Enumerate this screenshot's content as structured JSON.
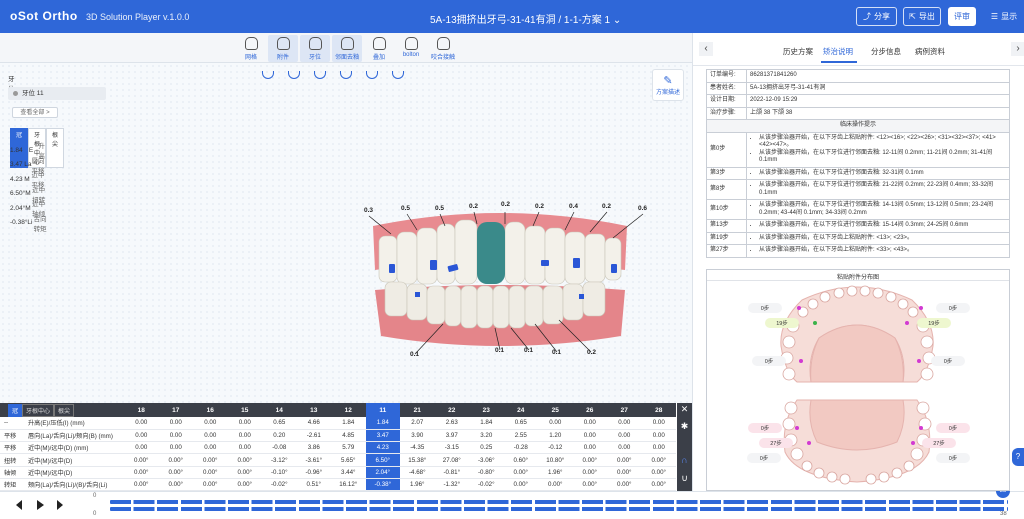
{
  "header": {
    "logo": "oSot Ortho",
    "app_name": "3D Solution Player v.1.0.0",
    "doc_title": "5A-13拥挤出牙弓-31-41有洞 / 1-1-方案 1",
    "share": "分享",
    "export": "导出",
    "review": "评审",
    "show": "显示"
  },
  "toolbar": [
    "网格",
    "附件",
    "牙位",
    "邻面去釉",
    "叠加",
    "bolton",
    "咬合接触"
  ],
  "plan_button": "方案描述",
  "left_panel": {
    "title": "牙位",
    "tooth": "牙位 11",
    "view_all": "查看全部 >",
    "tabs": [
      "冠",
      "牙根中心",
      "根尖"
    ],
    "rows": [
      {
        "v": "1.84",
        "c": "E",
        "d": "升高"
      },
      {
        "v": "3.47",
        "c": "La",
        "d": "唇向 平移"
      },
      {
        "v": "4.23",
        "c": "M",
        "d": "近中 平移"
      },
      {
        "v": "6.50°",
        "c": "M",
        "d": "近中 扭转"
      },
      {
        "v": "2.04°",
        "c": "M",
        "d": "近中 轴倾"
      },
      {
        "v": "-0.38°",
        "c": "Li",
        "d": "舌向 转矩"
      }
    ]
  },
  "tooth_tags_top": [
    "0.3",
    "0.5",
    "0.5",
    "0.2",
    "0.2",
    "0.2",
    "0.4",
    "0.2",
    "0.6"
  ],
  "tooth_tags_bottom": [
    "0.1",
    "0.1",
    "0.1",
    "0.1",
    "0.2"
  ],
  "bottom_table": {
    "tabs": [
      "冠",
      "牙根中心",
      "根尖"
    ],
    "teeth": [
      "18",
      "17",
      "16",
      "15",
      "14",
      "13",
      "12",
      "11",
      "21",
      "22",
      "23",
      "24",
      "25",
      "26",
      "27",
      "28"
    ],
    "rows": [
      {
        "c0": "--",
        "label": "升高(E)/压低(I) (mm)",
        "vals": [
          "0.00",
          "0.00",
          "0.00",
          "0.00",
          "0.65",
          "4.66",
          "1.84",
          "1.84",
          "2.07",
          "2.63",
          "1.84",
          "0.65",
          "0.00",
          "0.00",
          "0.00",
          "0.00"
        ]
      },
      {
        "c0": "平移",
        "label": "唇向(La)/舌向(Li)/颊向(B) (mm)",
        "vals": [
          "0.00",
          "0.00",
          "0.00",
          "0.00",
          "0.20",
          "-2.61",
          "4.85",
          "3.47",
          "3.90",
          "3.97",
          "3.20",
          "2.55",
          "1.20",
          "0.00",
          "0.00",
          "0.00"
        ]
      },
      {
        "c0": "平移",
        "label": "近中(M)/远中(D) (mm)",
        "vals": [
          "0.00",
          "0.00",
          "0.00",
          "0.00",
          "-0.08",
          "3.86",
          "5.79",
          "4.23",
          "-4.35",
          "-3.15",
          "0.25",
          "-0.28",
          "-0.12",
          "0.00",
          "0.00",
          "0.00"
        ]
      },
      {
        "c0": "扭转",
        "label": "近中(M)/远中(D)",
        "vals": [
          "0.00°",
          "0.00°",
          "0.00°",
          "0.00°",
          "-3.12°",
          "-3.61°",
          "5.65°",
          "6.50°",
          "15.38°",
          "27.08°",
          "-3.06°",
          "0.60°",
          "10.80°",
          "0.00°",
          "0.00°",
          "0.00°"
        ]
      },
      {
        "c0": "轴倾",
        "label": "近中(M)/远中(D)",
        "vals": [
          "0.00°",
          "0.00°",
          "0.00°",
          "0.00°",
          "-0.10°",
          "-0.96°",
          "3.44°",
          "2.04°",
          "-4.68°",
          "-0.81°",
          "-0.80°",
          "0.00°",
          "1.96°",
          "0.00°",
          "0.00°",
          "0.00°"
        ]
      },
      {
        "c0": "转矩",
        "label": "颊向(La)/舌向(Li)/(B)/舌向(Li)",
        "vals": [
          "0.00°",
          "0.00°",
          "0.00°",
          "0.00°",
          "-0.02°",
          "0.51°",
          "16.12°",
          "-0.38°",
          "1.96°",
          "-1.32°",
          "-0.02°",
          "0.00°",
          "0.00°",
          "0.00°",
          "0.00°",
          "0.00°"
        ]
      }
    ]
  },
  "timeline": {
    "start_top": "0",
    "start_bottom": "0",
    "end": "38",
    "current": "38"
  },
  "right_panel": {
    "tabs": [
      "历史方案",
      "矫治说明",
      "分步信息",
      "病例资料"
    ],
    "info": [
      {
        "k": "订单编号:",
        "v": "86281371841260"
      },
      {
        "k": "患者姓名:",
        "v": "5A-13拥挤出牙弓-31-41有洞"
      },
      {
        "k": "设计日期:",
        "v": "2022-12-09 15:29"
      },
      {
        "k": "治疗步骤:",
        "v": "上颌 38      下颌 38"
      }
    ],
    "clinical_title": "临床操作提示",
    "steps": [
      {
        "k": "第0步",
        "items": [
          "从该步骤治器开始，在以下牙齿上粘贴附件: <12><16>; <22><26>; <31><32><37>; <41><42><47>。",
          "从该步骤治器开始，在以下牙位进行邻面去釉: 12-11间 0.2mm; 11-21间 0.2mm; 31-41间 0.1mm"
        ]
      },
      {
        "k": "第3步",
        "items": [
          "从该步骤治器开始，在以下牙位进行邻面去釉: 32-31间 0.1mm"
        ]
      },
      {
        "k": "第8步",
        "items": [
          "从该步骤治器开始，在以下牙位进行邻面去釉: 21-22间 0.2mm; 22-23间 0.4mm; 33-32间 0.1mm"
        ]
      },
      {
        "k": "第10步",
        "items": [
          "从该步骤治器开始，在以下牙位进行邻面去釉: 14-13间 0.5mm; 13-12间 0.5mm; 23-24间 0.2mm; 43-44间 0.1mm; 34-33间 0.2mm"
        ]
      },
      {
        "k": "第13步",
        "items": [
          "从该步骤治器开始，在以下牙位进行邻面去釉: 15-14间 0.3mm; 24-25间 0.6mm"
        ]
      },
      {
        "k": "第19步",
        "items": [
          "从该步骤治器开始，在以下牙齿上粘贴附件: <13>; <23>。"
        ]
      },
      {
        "k": "第27步",
        "items": [
          "从该步骤治器开始，在以下牙齿上粘贴附件: <33>; <43>。"
        ]
      }
    ],
    "dist_title": "粘贴附件分布图",
    "pills_upper": [
      "0步",
      "0步",
      "19步",
      "19步",
      "0步",
      "0步"
    ],
    "pills_lower": [
      "0步",
      "0步",
      "27步",
      "27步",
      "0步",
      "0步"
    ]
  }
}
